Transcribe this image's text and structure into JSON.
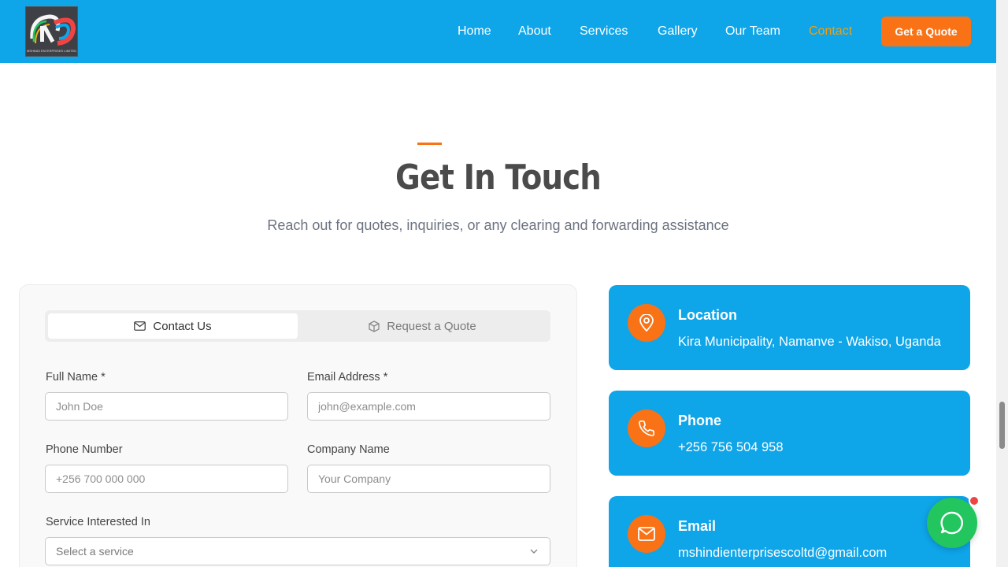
{
  "header": {
    "logo_text": "MSHINDI ENTERPRISES LIMITED",
    "nav": [
      {
        "label": "Home"
      },
      {
        "label": "About"
      },
      {
        "label": "Services"
      },
      {
        "label": "Gallery"
      },
      {
        "label": "Our Team"
      },
      {
        "label": "Contact",
        "active": true
      }
    ],
    "cta_label": "Get a Quote"
  },
  "section": {
    "title": "Get In Touch",
    "subtitle": "Reach out for quotes, inquiries, or any clearing and forwarding assistance"
  },
  "form": {
    "tabs": [
      {
        "label": "Contact Us",
        "icon": "mail-icon",
        "active": true
      },
      {
        "label": "Request a Quote",
        "icon": "package-icon",
        "active": false
      }
    ],
    "full_name": {
      "label": "Full Name *",
      "placeholder": "John Doe"
    },
    "email": {
      "label": "Email Address *",
      "placeholder": "john@example.com"
    },
    "phone": {
      "label": "Phone Number",
      "placeholder": "+256 700 000 000"
    },
    "company": {
      "label": "Company Name",
      "placeholder": "Your Company"
    },
    "service": {
      "label": "Service Interested In",
      "selected": "Select a service"
    }
  },
  "contact_info": [
    {
      "title": "Location",
      "value": "Kira Municipality, Namanve - Wakiso, Uganda",
      "icon": "map-pin-icon"
    },
    {
      "title": "Phone",
      "value": "+256 756 504 958",
      "icon": "phone-icon"
    },
    {
      "title": "Email",
      "value": "mshindienterprisescoltd@gmail.com",
      "icon": "mail-icon"
    }
  ],
  "colors": {
    "header_bg": "#0ea5e9",
    "accent": "#f97316",
    "nav_active": "#f59e0b",
    "chat_green": "#22c55e",
    "notification_red": "#ef4444"
  }
}
